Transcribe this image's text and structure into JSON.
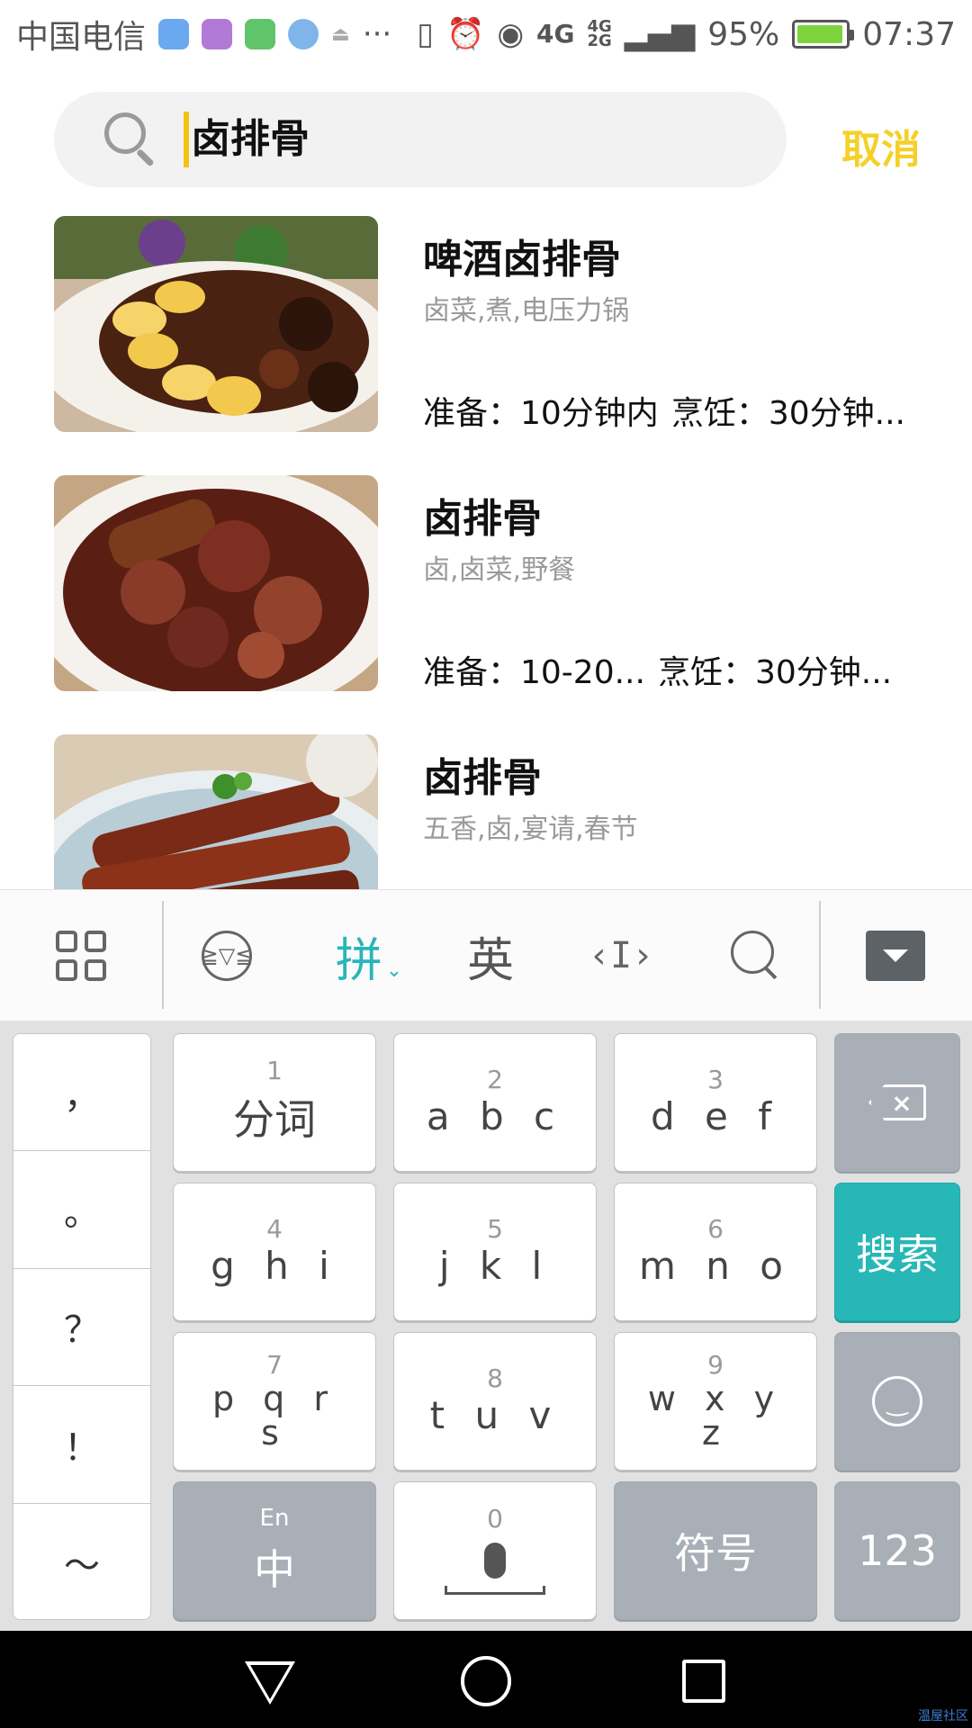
{
  "status_bar": {
    "carrier": "中国电信",
    "more": "···",
    "network": "4G",
    "network2": "4G\n2G",
    "battery_percent": "95%",
    "battery_level": 0.95,
    "time": "07:37",
    "icons": [
      "location-app-icon",
      "keyboard-app-icon",
      "briefcase-app-icon",
      "wifi-app-icon",
      "upload-icon",
      "vibrate-icon",
      "alarm-icon",
      "eye-icon",
      "data-arrows-icon",
      "signal-icon",
      "battery-icon"
    ]
  },
  "search": {
    "query": "卤排骨",
    "cancel_label": "取消"
  },
  "recipes": [
    {
      "title": "啤酒卤排骨",
      "tags": "卤菜,煮,电压力锅",
      "prep": "准备：10分钟内",
      "cook": "烹饪：30分钟..."
    },
    {
      "title": "卤排骨",
      "tags": "卤,卤菜,野餐",
      "prep": "准备：10-20...",
      "cook": "烹饪：30分钟..."
    },
    {
      "title": "卤排骨",
      "tags": "五香,卤,宴请,春节",
      "prep": "",
      "cook": ""
    }
  ],
  "ime_toolbar": {
    "pinyin_label": "拼",
    "english_label": "英",
    "cursor_label": "‹I›"
  },
  "keyboard": {
    "punctuation": [
      "，",
      "。",
      "？",
      "！",
      "～"
    ],
    "keys": {
      "k1": {
        "num": "1",
        "label": "分词"
      },
      "k2": {
        "num": "2",
        "label": "a b c"
      },
      "k3": {
        "num": "3",
        "label": "d e f"
      },
      "k4": {
        "num": "4",
        "label": "g h i"
      },
      "k5": {
        "num": "5",
        "label": "j k l"
      },
      "k6": {
        "num": "6",
        "label": "m n o"
      },
      "k7": {
        "num": "7",
        "label": "p q r\ns"
      },
      "k8": {
        "num": "8",
        "label": "t u v"
      },
      "k9": {
        "num": "9",
        "label": "w x y\nz"
      },
      "k0": {
        "num": "0"
      }
    },
    "backspace_label": "×",
    "search_label": "搜索",
    "lang_switch_small": "En",
    "lang_switch_main": "中",
    "symbol_label": "符号",
    "numeric_label": "123"
  },
  "watermark": "温屋社区",
  "colors": {
    "accent_yellow": "#f5d029",
    "accent_teal": "#27b7b6",
    "key_gray": "#a8afb7"
  }
}
